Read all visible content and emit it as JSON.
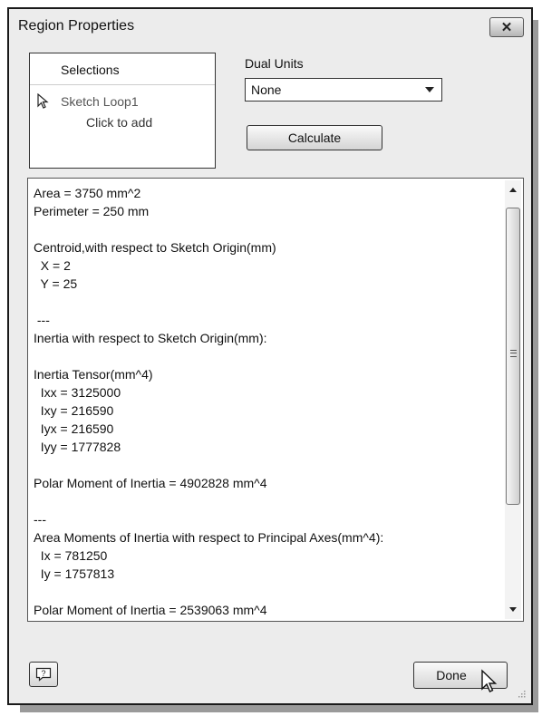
{
  "window": {
    "title": "Region Properties",
    "close_symbol": "✕",
    "icons": {
      "close": "close-icon",
      "help": "help-icon",
      "cursor": "mouse-pointer-icon",
      "resize": "resize-grip-icon"
    }
  },
  "selections": {
    "header": "Selections",
    "item_label": "Sketch Loop1",
    "click_to_add": "Click to add"
  },
  "dual_units": {
    "label": "Dual Units",
    "selected": "None"
  },
  "calculate_label": "Calculate",
  "results": {
    "lines": [
      "Area = 3750 mm^2",
      "Perimeter = 250 mm",
      "",
      "Centroid,with respect to Sketch Origin(mm)",
      "  X = 2",
      "  Y = 25",
      "",
      " ---",
      "Inertia with respect to Sketch Origin(mm):",
      "",
      "Inertia Tensor(mm^4)",
      "  Ixx = 3125000",
      "  Ixy = 216590",
      "  Iyx = 216590",
      "  Iyy = 1777828",
      "",
      "Polar Moment of Inertia = 4902828 mm^4",
      "",
      "---",
      "Area Moments of Inertia with respect to Principal Axes(mm^4):",
      "  Ix = 781250",
      "  Iy = 1757813",
      "",
      "Polar Moment of Inertia = 2539063 mm^4"
    ]
  },
  "done_label": "Done"
}
